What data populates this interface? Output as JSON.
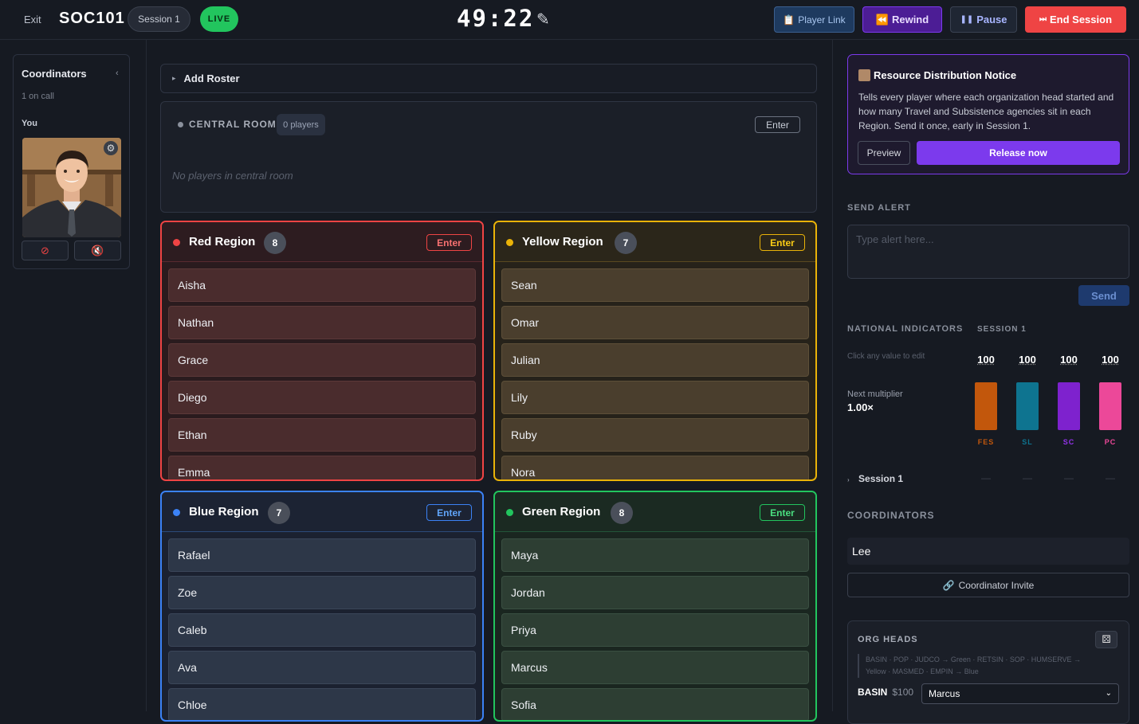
{
  "topbar": {
    "exit_label": "Exit",
    "course": "SOC101",
    "session": "Session 1",
    "live": "LIVE",
    "timer": "49:22",
    "edit_icon": "pencil-icon",
    "buttons": {
      "player_link": "Player Link",
      "rewind": "Rewind",
      "pause": "Pause",
      "end": "End Session"
    }
  },
  "left_panel": {
    "title": "Coordinators",
    "on_call": "1 on call",
    "you_label": "You"
  },
  "roster": {
    "add_label": "Add Roster"
  },
  "central": {
    "title": "CENTRAL ROOM",
    "count": "0 players",
    "enter": "Enter",
    "empty": "No players in central room"
  },
  "regions": [
    {
      "name": "Red Region",
      "count": "8",
      "enter": "Enter",
      "color": "#ef4444",
      "players": [
        "Aisha",
        "Nathan",
        "Grace",
        "Diego",
        "Ethan",
        "Emma"
      ]
    },
    {
      "name": "Yellow Region",
      "count": "7",
      "enter": "Enter",
      "color": "#eab308",
      "players": [
        "Sean",
        "Omar",
        "Julian",
        "Lily",
        "Ruby",
        "Nora"
      ]
    },
    {
      "name": "Blue Region",
      "count": "7",
      "enter": "Enter",
      "color": "#3b82f6",
      "players": [
        "Rafael",
        "Zoe",
        "Caleb",
        "Ava",
        "Chloe"
      ]
    },
    {
      "name": "Green Region",
      "count": "8",
      "enter": "Enter",
      "color": "#22c55e",
      "players": [
        "Maya",
        "Jordan",
        "Priya",
        "Marcus",
        "Sofia"
      ]
    }
  ],
  "notice": {
    "title": "Resource Distribution Notice",
    "body": "Tells every player where each organization head started and how many Travel and Subsistence agencies sit in each Region. Send it once, early in Session 1.",
    "preview": "Preview",
    "release": "Release now"
  },
  "alert": {
    "label": "SEND ALERT",
    "placeholder": "Type alert here...",
    "send": "Send"
  },
  "indicators": {
    "label": "NATIONAL INDICATORS",
    "session": "SESSION 1",
    "hint": "Click any value to edit",
    "next_label": "Next multiplier",
    "multiplier": "1.00×",
    "items": [
      {
        "code": "FES",
        "value": "100",
        "color": "#c2570c"
      },
      {
        "code": "SL",
        "value": "100",
        "color": "#0e7490"
      },
      {
        "code": "SC",
        "value": "100",
        "color": "#7e22ce"
      },
      {
        "code": "PC",
        "value": "100",
        "color": "#ec4899"
      }
    ],
    "session_row": "Session 1",
    "dash": "—"
  },
  "coordinators": {
    "label": "COORDINATORS",
    "name": "Lee",
    "invite": "Coordinator Invite"
  },
  "org_heads": {
    "label": "ORG HEADS",
    "map_line1": "BASIN · POP · JUDCO → Green · RETSIN · SOP · HUMSERVE →",
    "map_line2": "Yellow · MASMED · EMPIN → Blue",
    "row_name": "BASIN",
    "row_price": "$100",
    "row_value": "Marcus"
  }
}
